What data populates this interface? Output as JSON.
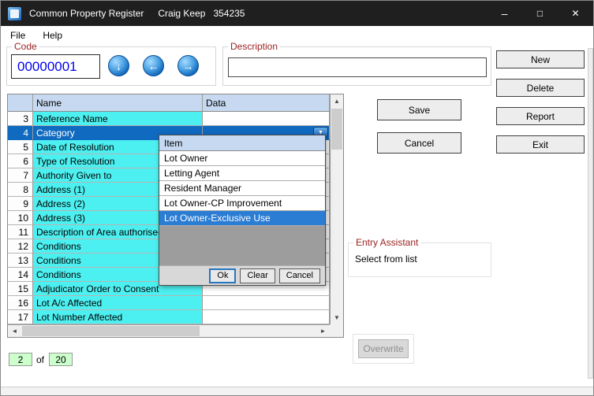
{
  "window": {
    "title": "Common Property Register",
    "user": "Craig Keep",
    "id": "354235",
    "controls": {
      "minimize": "–",
      "maximize": "□",
      "close": "✕"
    }
  },
  "menu": {
    "items": [
      {
        "label": "File"
      },
      {
        "label": "Help"
      }
    ]
  },
  "code_panel": {
    "label": "Code",
    "value": "00000001"
  },
  "description_panel": {
    "label": "Description",
    "value": ""
  },
  "icons": {
    "nav_down": "↓",
    "nav_prev": "←",
    "nav_next": "→",
    "dropdown": "▼",
    "scroll_up": "▲",
    "scroll_down": "▼",
    "scroll_left": "◄",
    "scroll_right": "►"
  },
  "action_buttons": [
    {
      "label": "New"
    },
    {
      "label": "Delete"
    },
    {
      "label": "Report"
    },
    {
      "label": "Exit"
    }
  ],
  "grid": {
    "columns": [
      "",
      "Name",
      "Data"
    ],
    "rows": [
      {
        "num": "3",
        "name": "Reference Name",
        "data": "",
        "selected": false
      },
      {
        "num": "4",
        "name": "Category",
        "data": "",
        "selected": true
      },
      {
        "num": "5",
        "name": "Date of Resolution",
        "data": "",
        "selected": false
      },
      {
        "num": "6",
        "name": "Type of Resolution",
        "data": "",
        "selected": false
      },
      {
        "num": "7",
        "name": "Authority Given to",
        "data": "",
        "selected": false
      },
      {
        "num": "8",
        "name": "Address (1)",
        "data": "",
        "selected": false
      },
      {
        "num": "9",
        "name": "Address (2)",
        "data": "",
        "selected": false
      },
      {
        "num": "10",
        "name": "Address (3)",
        "data": "",
        "selected": false
      },
      {
        "num": "11",
        "name": "Description of Area authorised for",
        "data": "",
        "selected": false
      },
      {
        "num": "12",
        "name": "Conditions",
        "data": "",
        "selected": false
      },
      {
        "num": "13",
        "name": "Conditions",
        "data": "",
        "selected": false
      },
      {
        "num": "14",
        "name": "Conditions",
        "data": "",
        "selected": false
      },
      {
        "num": "15",
        "name": "Adjudicator Order to Consent",
        "data": "",
        "selected": false
      },
      {
        "num": "16",
        "name": "Lot A/c Affected",
        "data": "",
        "selected": false
      },
      {
        "num": "17",
        "name": "Lot Number Affected",
        "data": "",
        "selected": false
      }
    ]
  },
  "popup": {
    "header": "Item",
    "items": [
      "Lot Owner",
      "Letting Agent",
      "Resident Manager",
      "Lot Owner-CP Improvement",
      "Lot Owner-Exclusive Use"
    ],
    "selected_index": 4,
    "buttons": [
      "Ok",
      "Clear",
      "Cancel"
    ]
  },
  "side_buttons": {
    "save": "Save",
    "cancel": "Cancel"
  },
  "entry_assistant": {
    "title": "Entry Assistant",
    "text": "Select from list"
  },
  "overwrite": {
    "label": "Overwrite",
    "disabled": true
  },
  "record_nav": {
    "current": "2",
    "of_label": "of",
    "total": "20"
  },
  "colors": {
    "accent_blue": "#0f6ac0",
    "cell_cyan": "#4df0f0",
    "label_maroon": "#9c2222",
    "record_green": "#ccffcc",
    "header_blue": "#c6d9f0",
    "titlebar": "#1f1f1f"
  }
}
